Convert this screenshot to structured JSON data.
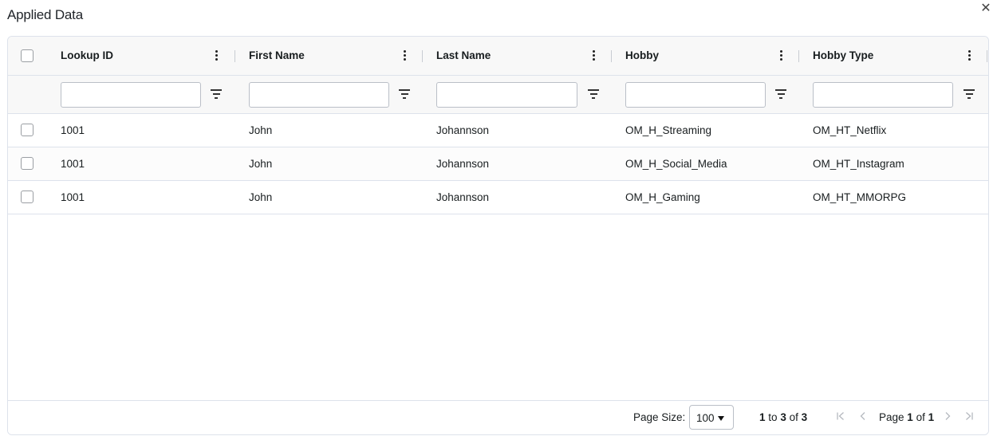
{
  "dialog": {
    "title": "Applied Data",
    "close_glyph": "✕"
  },
  "grid": {
    "columns": [
      {
        "key": "lookup_id",
        "label": "Lookup ID"
      },
      {
        "key": "first_name",
        "label": "First Name"
      },
      {
        "key": "last_name",
        "label": "Last Name"
      },
      {
        "key": "hobby",
        "label": "Hobby"
      },
      {
        "key": "hobby_type",
        "label": "Hobby Type"
      }
    ],
    "filters": {
      "lookup_id": "",
      "first_name": "",
      "last_name": "",
      "hobby": "",
      "hobby_type": ""
    },
    "rows": [
      {
        "lookup_id": "1001",
        "first_name": "John",
        "last_name": "Johannson",
        "hobby": "OM_H_Streaming",
        "hobby_type": "OM_HT_Netflix",
        "selected": false
      },
      {
        "lookup_id": "1001",
        "first_name": "John",
        "last_name": "Johannson",
        "hobby": "OM_H_Social_Media",
        "hobby_type": "OM_HT_Instagram",
        "selected": false
      },
      {
        "lookup_id": "1001",
        "first_name": "John",
        "last_name": "Johannson",
        "hobby": "OM_H_Gaming",
        "hobby_type": "OM_HT_MMORPG",
        "selected": false
      }
    ]
  },
  "pagination": {
    "page_size_label": "Page Size:",
    "page_size": "100",
    "row_from": "1",
    "row_to_word": "to",
    "row_to": "3",
    "of_word": "of",
    "row_total": "3",
    "page_word": "Page",
    "page_current": "1",
    "page_total": "1",
    "icons": [
      "first-page-icon",
      "previous-page-icon",
      "next-page-icon",
      "last-page-icon"
    ]
  },
  "colors": {
    "border": "#dde2eb",
    "header_bg": "#f8f8f8",
    "disabled_icon": "#b5b9bf"
  }
}
